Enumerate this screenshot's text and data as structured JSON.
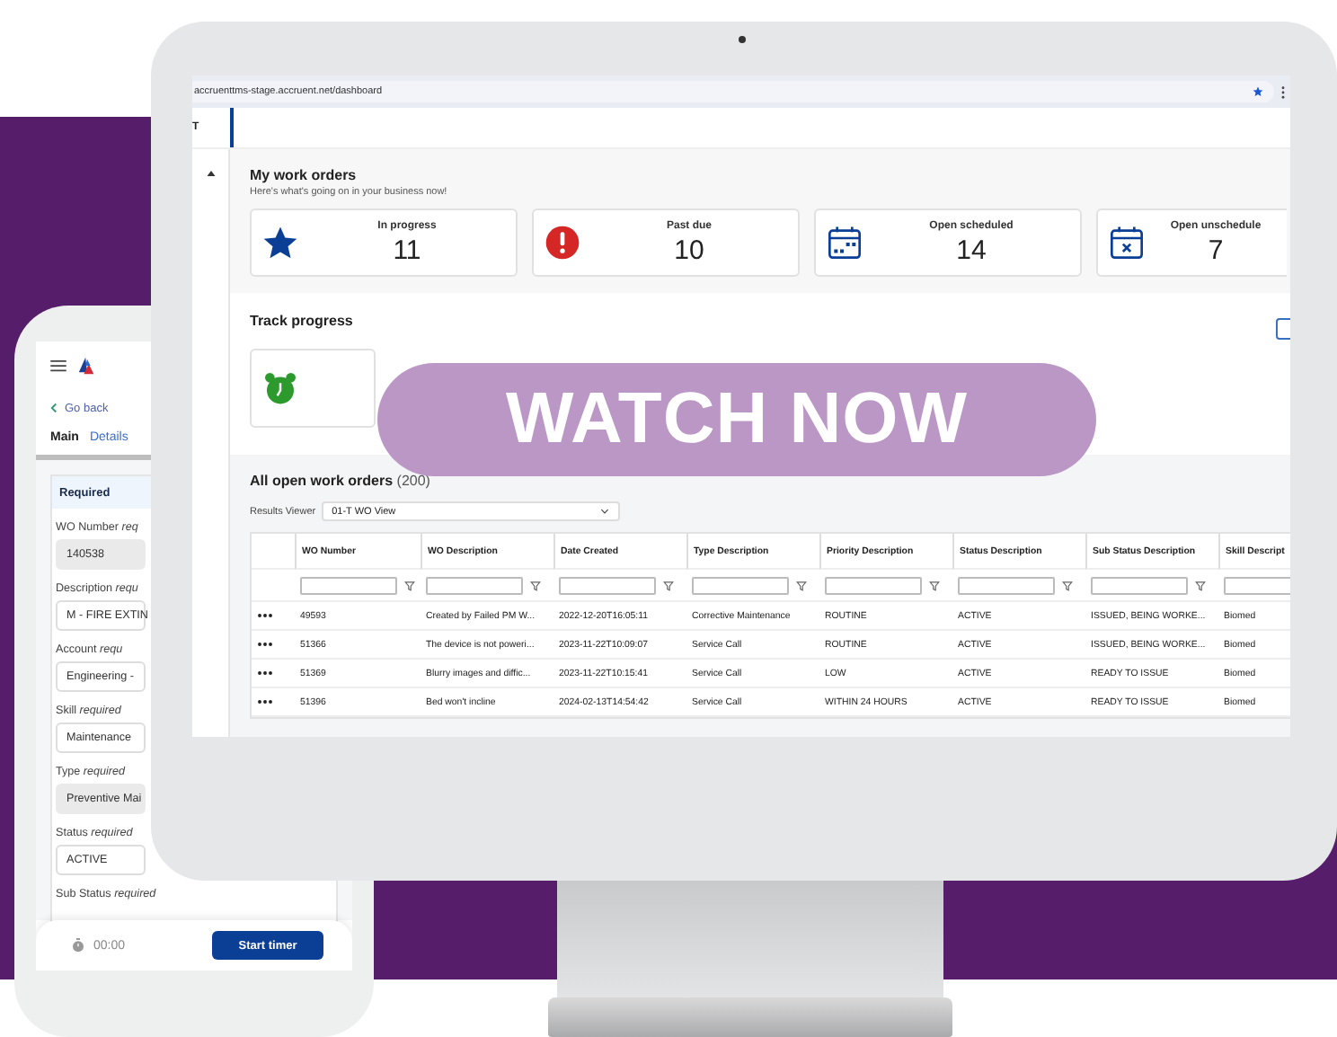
{
  "browser": {
    "url": "accruenttms-stage.accruent.net/dashboard"
  },
  "app_header": {
    "label": "T"
  },
  "my_work_orders": {
    "title": "My work orders",
    "subtitle": "Here's what's going on in your business now!",
    "cards": [
      {
        "kind": "star",
        "label": "In progress",
        "count": "11"
      },
      {
        "kind": "alert",
        "label": "Past due",
        "count": "10"
      },
      {
        "kind": "scheduled",
        "label": "Open scheduled",
        "count": "14"
      },
      {
        "kind": "unscheduled",
        "label": "Open unschedule",
        "count": "7"
      }
    ]
  },
  "track_progress": {
    "title": "Track progress"
  },
  "open_work_orders": {
    "title": "All open work orders",
    "count": "(200)",
    "results_viewer": {
      "label": "Results Viewer",
      "value": "01-T WO View"
    },
    "table": {
      "columns": [
        "WO Number",
        "WO Description",
        "Date Created",
        "Type Description",
        "Priority Description",
        "Status Description",
        "Sub Status Description",
        "Skill Descript"
      ],
      "rows": [
        [
          "49593",
          "Created by Failed PM W...",
          "2022-12-20T16:05:11",
          "Corrective Maintenance",
          "ROUTINE",
          "ACTIVE",
          "ISSUED, BEING WORKE...",
          "Biomed"
        ],
        [
          "51366",
          "The device is not poweri...",
          "2023-11-22T10:09:07",
          "Service Call",
          "ROUTINE",
          "ACTIVE",
          "ISSUED, BEING WORKE...",
          "Biomed"
        ],
        [
          "51369",
          "Blurry images and diffic...",
          "2023-11-22T10:15:41",
          "Service Call",
          "LOW",
          "ACTIVE",
          "READY TO ISSUE",
          "Biomed"
        ],
        [
          "51396",
          "Bed won't incline",
          "2024-02-13T14:54:42",
          "Service Call",
          "WITHIN 24 HOURS",
          "ACTIVE",
          "READY TO ISSUE",
          "Biomed"
        ]
      ]
    }
  },
  "promo": {
    "button": "WATCH NOW"
  },
  "phone": {
    "back": "Go back",
    "tabs": [
      {
        "label": "Main",
        "selected": true
      },
      {
        "label": "Details",
        "selected": false
      }
    ],
    "section": "Required",
    "fields": [
      {
        "label": "WO Number *req*",
        "value": "140538",
        "disabled": true
      },
      {
        "label": "Description *requ*",
        "value": "M - FIRE EXTIN",
        "disabled": false
      },
      {
        "label": "Account *requ*",
        "value": "Engineering -",
        "disabled": false
      },
      {
        "label": "Skill *required*",
        "value": "Maintenance",
        "disabled": false
      },
      {
        "label": "Type *required*",
        "value": "Preventive Mai",
        "disabled": true
      },
      {
        "label": "Status *required*",
        "value": "ACTIVE",
        "disabled": false
      },
      {
        "label": "Sub Status *required*"
      }
    ],
    "timer": "00:00",
    "start_button": "Start timer"
  }
}
